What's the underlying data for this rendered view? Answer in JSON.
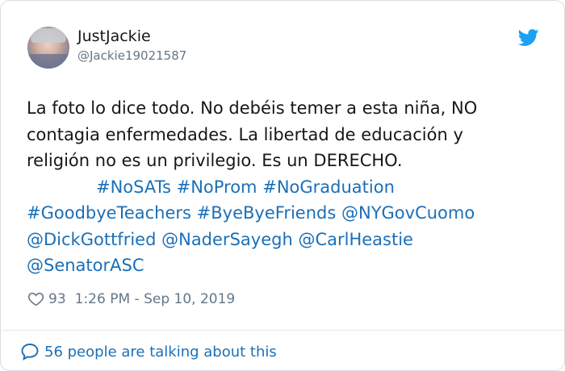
{
  "author": {
    "name": "JustJackie",
    "handle": "@Jackie19021587"
  },
  "tweet": {
    "line1": "La foto lo dice todo. No debéis temer a esta niña, NO",
    "line2": "contagia enfermedades. La libertad de educación y",
    "line3": "religión no es un privilegio. Es un DERECHO.",
    "hashtags_row1": [
      "#NoSATs",
      "#NoProm",
      "#NoGraduation"
    ],
    "row2": [
      "#GoodbyeTeachers",
      "#ByeByeFriends",
      "@NYGovCuomo"
    ],
    "row3": [
      "@DickGottfried",
      "@NaderSayegh",
      "@CarlHeastie"
    ],
    "row4": [
      "@SenatorASC"
    ]
  },
  "meta": {
    "likes": "93",
    "timestamp": "1:26 PM - Sep 10, 2019"
  },
  "footer": {
    "talking": "56 people are talking about this"
  },
  "icons": {
    "platform": "twitter-bird-icon",
    "like": "heart-icon",
    "reply": "speech-bubble-icon"
  },
  "colors": {
    "link": "#1b6fb8",
    "brand": "#1da1f2",
    "muted": "#657786",
    "text": "#14171a"
  }
}
